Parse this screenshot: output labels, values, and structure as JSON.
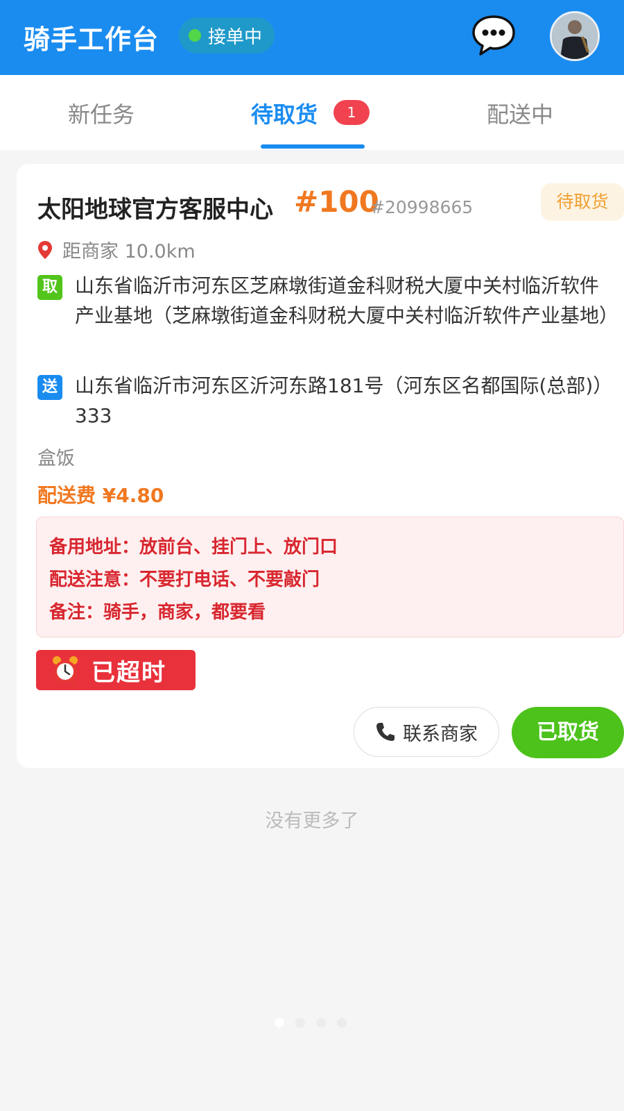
{
  "header": {
    "title": "骑手工作台",
    "status": "接单中",
    "status_color": "#52d64a",
    "chat_icon": "chat-bubble-icon",
    "avatar": "user-avatar"
  },
  "tabs": [
    {
      "label": "新任务",
      "active": false
    },
    {
      "label": "待取货",
      "active": true,
      "badge": "1"
    },
    {
      "label": "配送中",
      "active": false
    }
  ],
  "order": {
    "shop_name": "太阳地球官方客服中心",
    "order_no": "#100",
    "order_id": "#20998665",
    "state": "待取货",
    "distance": "距商家 10.0km",
    "pickup_tag": "取",
    "pickup_address": "山东省临沂市河东区芝麻墩街道金科财税大厦中关村临沂软件产业基地（芝麻墩街道金科财税大厦中关村临沂软件产业基地）",
    "delivery_tag": "送",
    "delivery_address": "山东省临沂市河东区沂河东路181号（河东区名都国际(总部)） 333",
    "items": "盒饭",
    "fee": "配送费 ¥4.80",
    "notes": [
      "备用地址：放前台、挂门上、放门口",
      "配送注意：不要打电话、不要敲门",
      "备注：骑手，商家，都要看"
    ],
    "timeout": "已超时",
    "contact_button": "联系商家",
    "pickup_button": "已取货"
  },
  "footer": {
    "no_more": "没有更多了",
    "pager_count": 4,
    "pager_active": 0
  },
  "colors": {
    "primary": "#1a8cf0",
    "accent_orange": "#f07820",
    "danger": "#e8313b",
    "success": "#4cc21b"
  }
}
